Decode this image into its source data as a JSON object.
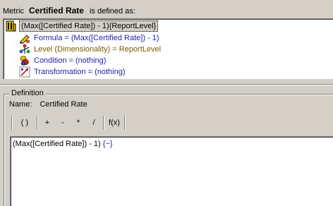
{
  "header": {
    "prefix": "Metric",
    "metric_name": "Certified Rate",
    "suffix": "is defined as:"
  },
  "tree": {
    "root": {
      "label": "(Max([Certified Rate]) - 1){ReportLevel}",
      "icon": "metric-icon"
    },
    "children": [
      {
        "label": "Formula = (Max([Certified Rate]) - 1)",
        "icon": "formula-pencil-icon"
      },
      {
        "label": "Level (Dimensionality) = ReportLevel",
        "icon": "level-dimensionality-icon"
      },
      {
        "label": "Condition = (nothing)",
        "icon": "condition-filter-icon"
      },
      {
        "label": "Transformation = (nothing)",
        "icon": "transformation-icon"
      }
    ]
  },
  "definition": {
    "group_title": "Definition",
    "name_label": "Name:",
    "name_value": "Certified Rate",
    "toolbar": {
      "parens": "( )",
      "plus": "+",
      "minus": "-",
      "multiply": "*",
      "divide": "/",
      "function": "f(x)"
    },
    "expression": "(Max([Certified Rate]) - 1)",
    "expression_tail": "{~}"
  },
  "colors": {
    "background": "#d4d0c8",
    "tree_text_blue": "#1e1eaa",
    "tree_text_level": "#7a5a00"
  }
}
